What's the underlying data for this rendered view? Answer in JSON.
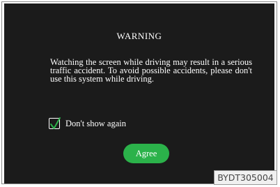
{
  "dialog": {
    "title": "WARNING",
    "message": "Watching the screen while driving may result in a serious traffic accident. To avoid possible accidents, please don't use this system while driving.",
    "checkbox": {
      "label": "Don't show again",
      "checked": true
    },
    "agree_label": "Agree"
  },
  "figure_code": "BYDT305004",
  "colors": {
    "screen_background": "#1b1b1b",
    "button": "#2bb24a",
    "checkmark": "#2bb24a"
  },
  "icons": {
    "checkbox": "checkmark-icon"
  }
}
